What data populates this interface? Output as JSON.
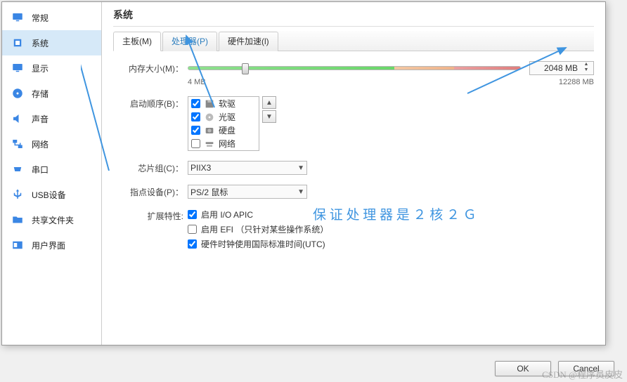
{
  "section_title": "系统",
  "sidebar": {
    "items": [
      {
        "label": "常规",
        "icon": "monitor",
        "color": "#3a86e4"
      },
      {
        "label": "系统",
        "icon": "chip",
        "color": "#3a86e4",
        "selected": true
      },
      {
        "label": "显示",
        "icon": "monitor",
        "color": "#3a86e4"
      },
      {
        "label": "存储",
        "icon": "disk",
        "color": "#3a86e4"
      },
      {
        "label": "声音",
        "icon": "speaker",
        "color": "#3a86e4"
      },
      {
        "label": "网络",
        "icon": "net",
        "color": "#3a86e4"
      },
      {
        "label": "串口",
        "icon": "serial",
        "color": "#3a86e4"
      },
      {
        "label": "USB设备",
        "icon": "usb",
        "color": "#3a86e4"
      },
      {
        "label": "共享文件夹",
        "icon": "folder",
        "color": "#3a86e4"
      },
      {
        "label": "用户界面",
        "icon": "ui",
        "color": "#3a86e4"
      }
    ]
  },
  "tabs": [
    {
      "label": "主板(M)",
      "active": true
    },
    {
      "label": "处理器(P)",
      "highlighted": true
    },
    {
      "label": "硬件加速(l)"
    }
  ],
  "memory": {
    "label": "内存大小(M)：",
    "value": "2048",
    "unit": "MB",
    "scale_min": "4 MB",
    "scale_max": "12288 MB"
  },
  "boot": {
    "label": "启动顺序(B)：",
    "items": [
      {
        "label": "软驱",
        "icon": "floppy",
        "checked": true
      },
      {
        "label": "光驱",
        "icon": "cd",
        "checked": true
      },
      {
        "label": "硬盘",
        "icon": "hdd",
        "checked": true
      },
      {
        "label": "网络",
        "icon": "netboot",
        "checked": false
      }
    ]
  },
  "chipset": {
    "label": "芯片组(C)：",
    "value": "PIIX3"
  },
  "pointing": {
    "label": "指点设备(P)：",
    "value": "PS/2 鼠标"
  },
  "extended": {
    "label": "扩展特性:",
    "opts": [
      {
        "label": "启用 I/O APIC",
        "checked": true
      },
      {
        "label": "启用 EFI （只针对某些操作系统）",
        "checked": false
      },
      {
        "label": "硬件时钟使用国际标准时间(UTC)",
        "checked": true
      }
    ]
  },
  "annotation": "保 证 处 理 器 是 ２ 核 ２ Ｇ",
  "footer": {
    "ok": "OK",
    "cancel": "Cancel"
  },
  "watermark": "CSDN @程序员皮皮"
}
